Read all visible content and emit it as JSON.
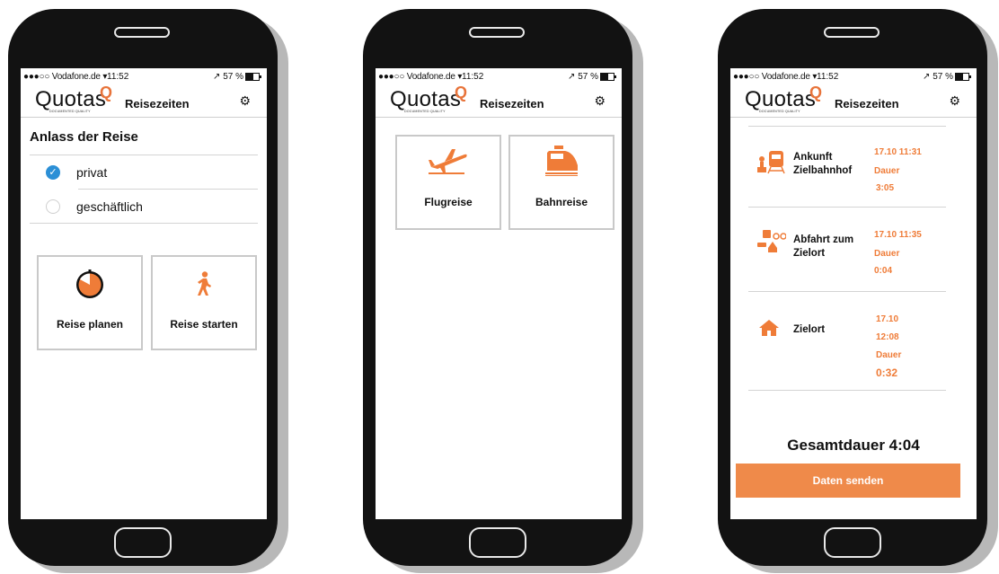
{
  "status_bar": {
    "carrier": "●●●○○ Vodafone.de",
    "time": "11:52",
    "battery": "57 %"
  },
  "app": {
    "logo_text": "Quotas",
    "logo_tagline": "DOCUMENTED QUALITY",
    "title": "Reisezeiten",
    "gear_icon": "gear-icon"
  },
  "screen1": {
    "section_title": "Anlass der Reise",
    "options": [
      {
        "label": "privat",
        "checked": true
      },
      {
        "label": "geschäftlich",
        "checked": false
      }
    ],
    "tiles": [
      {
        "label": "Reise planen",
        "icon": "timer-icon"
      },
      {
        "label": "Reise starten",
        "icon": "walking-person-icon"
      }
    ]
  },
  "screen2": {
    "tiles": [
      {
        "label": "Flugreise",
        "icon": "airplane-icon"
      },
      {
        "label": "Bahnreise",
        "icon": "train-icon"
      }
    ]
  },
  "screen3": {
    "steps": [
      {
        "name_line1": "Ankunft",
        "name_line2": "Zielbahnhof",
        "datetime": "17.10 11:31",
        "duration_label": "Dauer",
        "duration": "3:05",
        "icon": "station-icon"
      },
      {
        "name_line1": "Abfahrt zum",
        "name_line2": "Zielort",
        "datetime": "17.10 11:35",
        "duration_label": "Dauer",
        "duration": "0:04",
        "icon": "transport-modes-icon"
      },
      {
        "name_line1": "Zielort",
        "name_line2": "",
        "date": "17.10",
        "time": "12:08",
        "duration_label": "Dauer",
        "duration": "0:32",
        "icon": "home-icon"
      }
    ],
    "total": "Gesamtdauer 4:04",
    "send_button": "Daten senden"
  },
  "colors": {
    "accent": "#ef7c38",
    "button": "#ef8a4a",
    "check": "#2b8fd6",
    "phone": "#121212"
  }
}
